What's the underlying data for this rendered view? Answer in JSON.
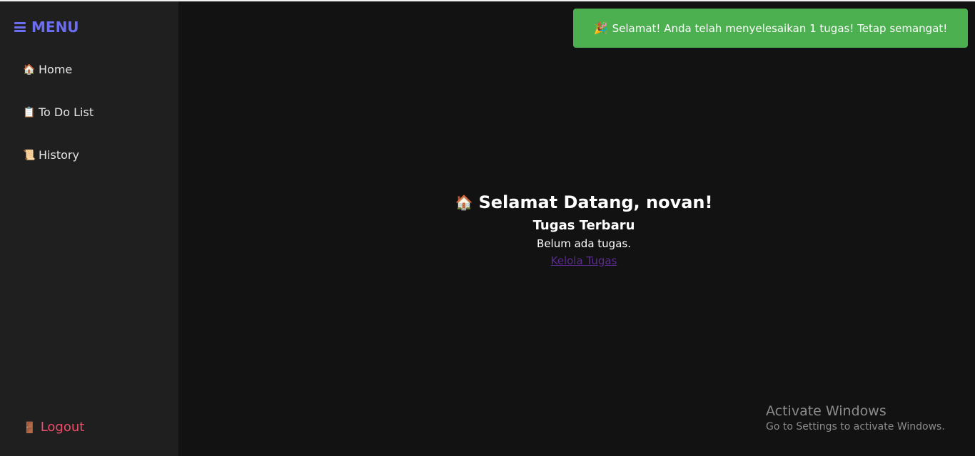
{
  "sidebar": {
    "menu_title": "MENU",
    "items": [
      {
        "icon": "🏠",
        "label": "Home"
      },
      {
        "icon": "📋",
        "label": "To Do List"
      },
      {
        "icon": "📜",
        "label": "History"
      }
    ],
    "logout": {
      "icon": "🚪",
      "label": "Logout"
    }
  },
  "toast": {
    "icon": "🎉",
    "message": "Selamat! Anda telah menyelesaikan 1 tugas! Tetap semangat!"
  },
  "main": {
    "icon": "🏠",
    "title": "Selamat Datang, novan!",
    "subtitle": "Tugas Terbaru",
    "empty_text": "Belum ada tugas.",
    "link_label": "Kelola Tugas"
  },
  "watermark": {
    "title": "Activate Windows",
    "subtitle": "Go to Settings to activate Windows."
  },
  "colors": {
    "menu_accent": "#6b6ef0",
    "toast_bg": "#4caf50",
    "logout": "#ef4d6b",
    "link": "#5b2c8f"
  }
}
